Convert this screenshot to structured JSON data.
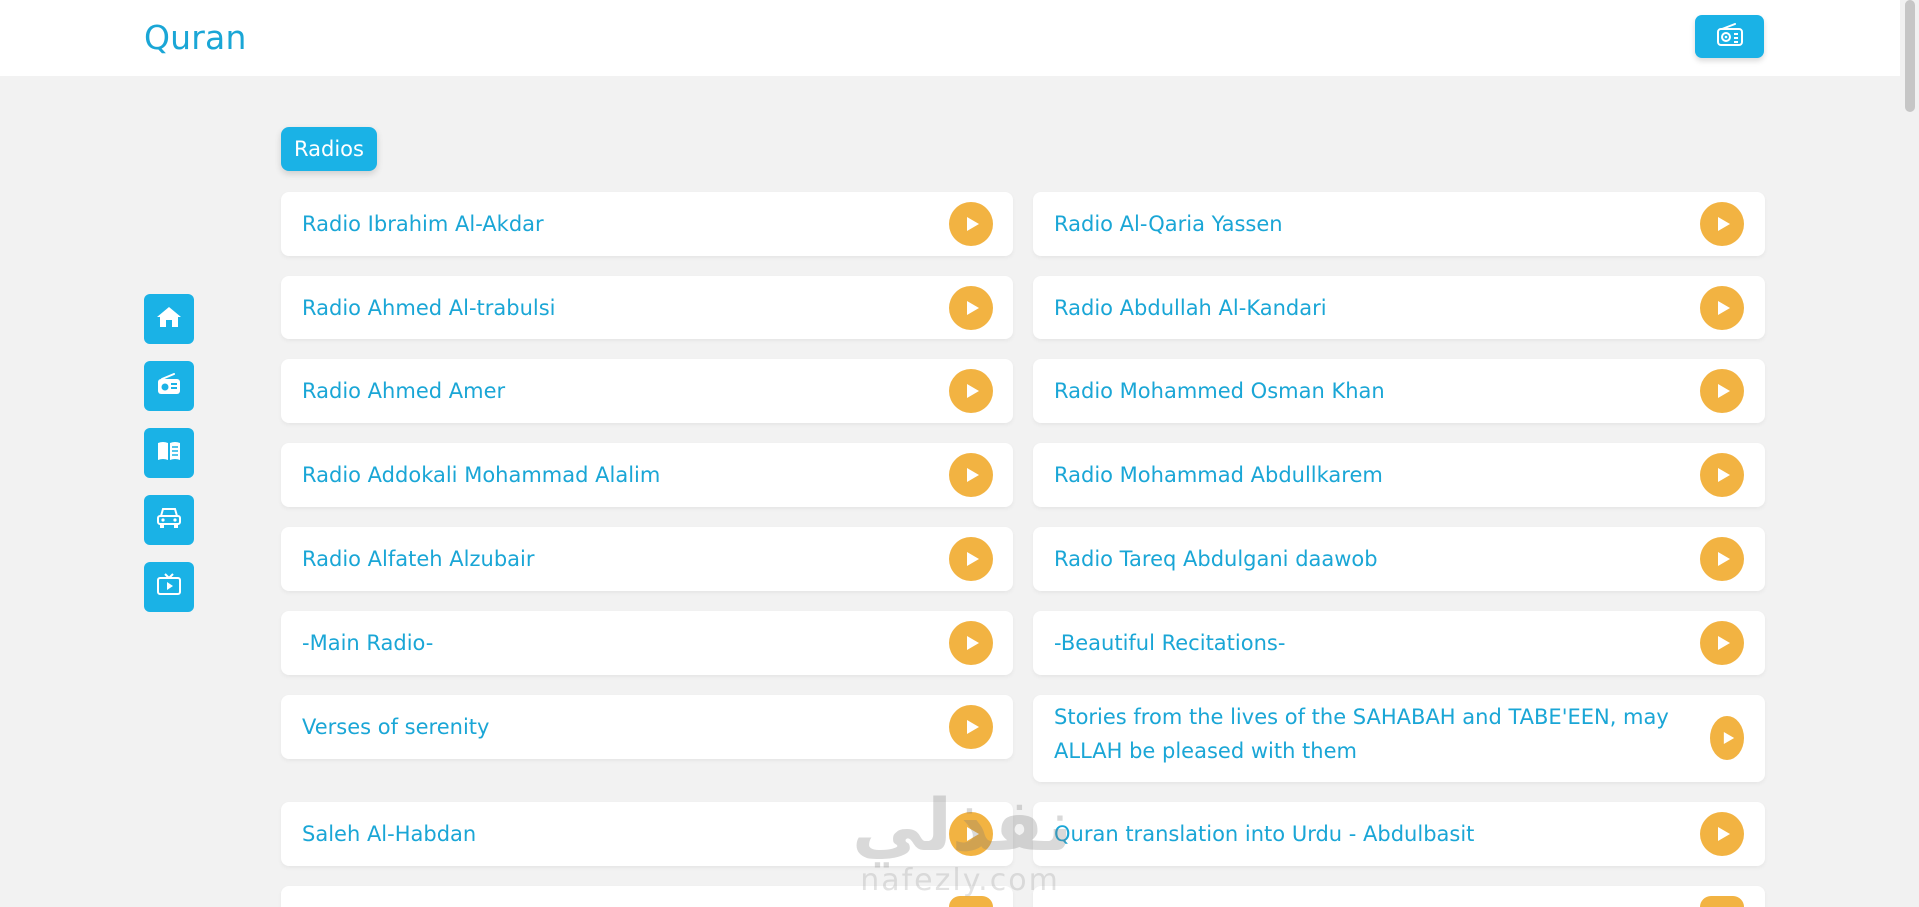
{
  "header": {
    "brand": "Quran"
  },
  "section": {
    "title": "Radios"
  },
  "side_nav": [
    {
      "icon": "home-icon"
    },
    {
      "icon": "radio-icon"
    },
    {
      "icon": "book-icon"
    },
    {
      "icon": "car-icon"
    },
    {
      "icon": "tv-icon"
    }
  ],
  "radios": [
    "Radio Ibrahim Al-Akdar",
    "Radio Al-Qaria Yassen",
    "Radio Ahmed Al-trabulsi",
    "Radio Abdullah Al-Kandari",
    "Radio Ahmed Amer",
    "Radio Mohammed Osman Khan",
    "Radio Addokali Mohammad Alalim",
    "Radio Mohammad Abdullkarem",
    "Radio Alfateh Alzubair",
    "Radio Tareq Abdulgani daawob",
    "-Main Radio-",
    "-Beautiful Recitations-",
    "Verses of serenity",
    "Stories from the lives of the SAHABAH and TABE'EEN, may ALLAH be pleased with them",
    "Saleh Al-Habdan",
    "Quran translation into Urdu - Abdulbasit",
    "",
    ""
  ],
  "watermark": {
    "arabic": "نفذلي",
    "latin": "nafezly.com"
  },
  "colors": {
    "primary": "#1ab2e6",
    "text": "#1aa6d6",
    "play": "#f2b342",
    "background": "#f2f2f2"
  }
}
